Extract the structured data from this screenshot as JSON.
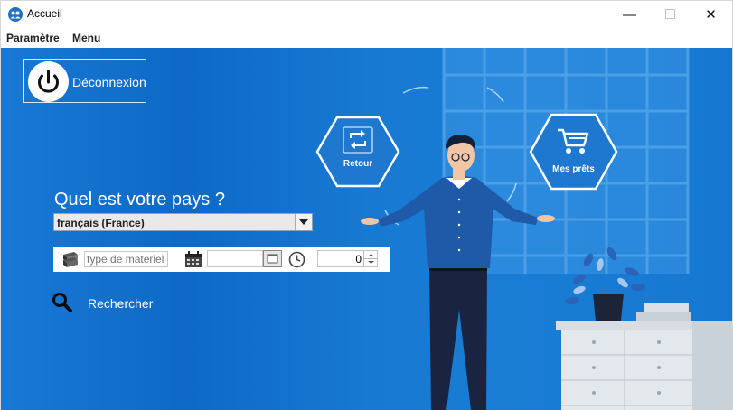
{
  "window": {
    "title": "Accueil",
    "controls": {
      "minimize": "—",
      "maximize": "☐",
      "close": "✕"
    }
  },
  "menubar": {
    "items": [
      "Paramètre",
      "Menu"
    ]
  },
  "logout": {
    "label": "Déconnexion",
    "icon": "power-icon"
  },
  "country": {
    "question": "Quel est votre pays ?",
    "selected": "français (France)"
  },
  "filters": {
    "material_placeholder": "type de materiel",
    "date_value": "",
    "spinner_value": "0"
  },
  "search": {
    "label": "Rechercher"
  },
  "actions": {
    "retour": {
      "label": "Retour",
      "icon": "refresh-icon"
    },
    "mes_prets": {
      "label": "Mes prêts",
      "icon": "cart-icon"
    }
  },
  "colors": {
    "background": "#1879d4",
    "accent_white": "#ffffff"
  }
}
